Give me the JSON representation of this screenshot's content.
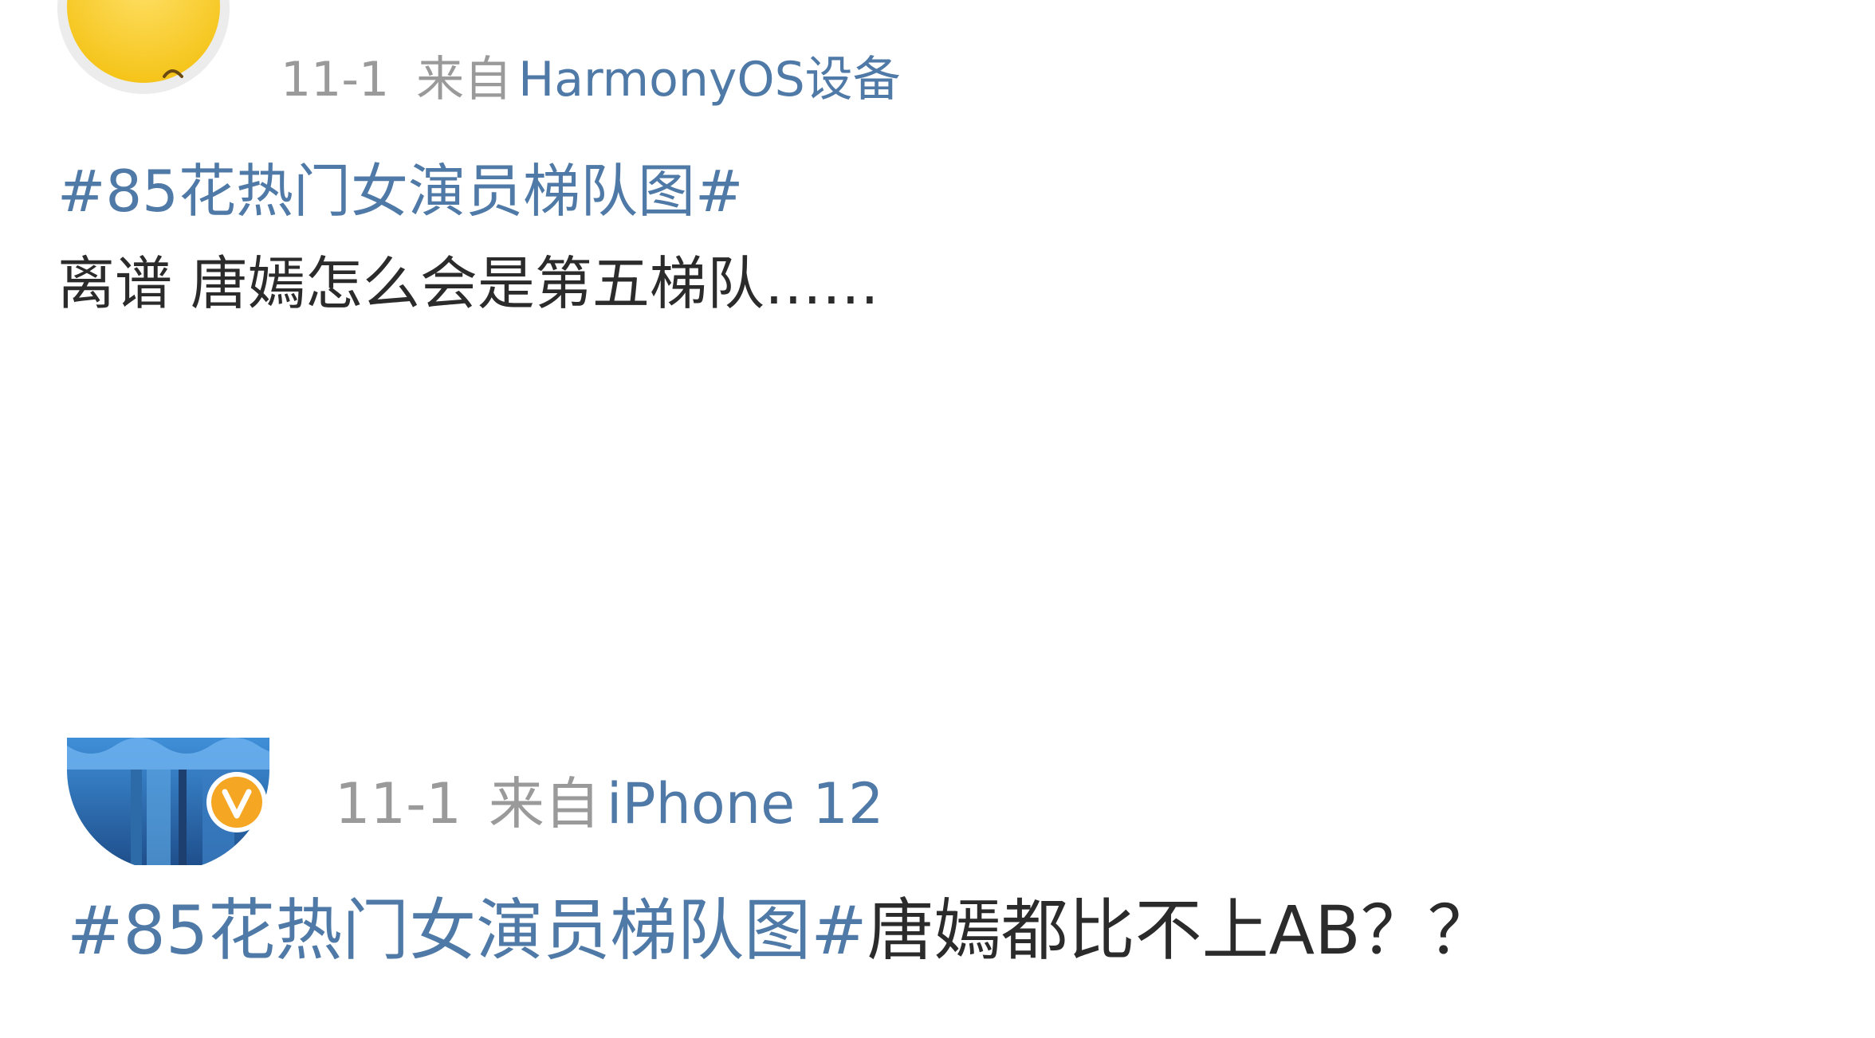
{
  "posts": [
    {
      "date": "11-1",
      "source_prefix": "来自",
      "device": "HarmonyOS设备",
      "topic": "#85花热门女演员梯队图#",
      "text": "离谱 唐嫣怎么会是第五梯队……",
      "avatar_icon": "yellow-avatar",
      "verified": false
    },
    {
      "date": "11-1",
      "source_prefix": "来自",
      "device": "iPhone 12",
      "topic": "#85花热门女演员梯队图#",
      "text": "唐嫣都比不上AB？？",
      "avatar_icon": "blue-photo-avatar",
      "verified": true,
      "badge_icon": "verified-v-badge"
    }
  ],
  "colors": {
    "topic": "#4f79a6",
    "meta": "#9a9a9a",
    "text": "#2b2b2b",
    "badge": "#f5a623"
  }
}
